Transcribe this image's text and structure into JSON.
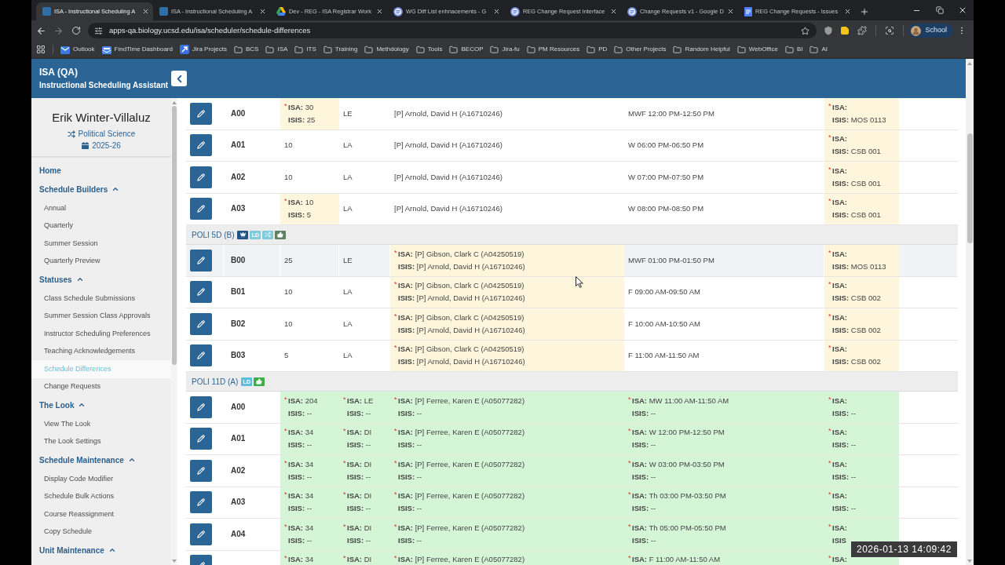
{
  "browser": {
    "tabs": [
      {
        "title": "ISA - Instructional Scheduling A",
        "kind": "app",
        "selected": true
      },
      {
        "title": "ISA - Instructional Scheduling A",
        "kind": "app",
        "selected": false
      },
      {
        "title": "Dev - REG - ISA Registrar Work",
        "kind": "drive",
        "selected": false
      },
      {
        "title": "WG Diff List enhnacements - G",
        "kind": "round",
        "selected": false
      },
      {
        "title": "REG Change Request Interface",
        "kind": "round",
        "selected": false
      },
      {
        "title": "Change Requests v1 - Google D",
        "kind": "round",
        "selected": false
      },
      {
        "title": "REG Change Requests - Issues",
        "kind": "doc",
        "selected": false
      }
    ],
    "address": "apps-qa.biology.ucsd.edu/isa/scheduler/schedule-differences",
    "profile": "School",
    "bookmarks": [
      {
        "label": "Outlook",
        "kind": "outlook"
      },
      {
        "label": "FindTime Dashboard",
        "kind": "findtime"
      },
      {
        "label": "Jira Projects",
        "kind": "jira"
      },
      {
        "label": "BCS",
        "kind": "folder"
      },
      {
        "label": "ISA",
        "kind": "folder"
      },
      {
        "label": "ITS",
        "kind": "folder"
      },
      {
        "label": "Training",
        "kind": "folder"
      },
      {
        "label": "Methdology",
        "kind": "folder"
      },
      {
        "label": "Tools",
        "kind": "folder"
      },
      {
        "label": "BECOP",
        "kind": "folder"
      },
      {
        "label": "Jira-fu",
        "kind": "folder"
      },
      {
        "label": "PM Resources",
        "kind": "folder"
      },
      {
        "label": "PD",
        "kind": "folder"
      },
      {
        "label": "Other Projects",
        "kind": "folder"
      },
      {
        "label": "Random Helpful",
        "kind": "folder"
      },
      {
        "label": "WebOffice",
        "kind": "folder"
      },
      {
        "label": "BI",
        "kind": "folder"
      },
      {
        "label": "AI",
        "kind": "folder"
      }
    ]
  },
  "header": {
    "title": "ISA (QA)",
    "subtitle": "Instructional Scheduling Assistant"
  },
  "sidebar": {
    "user": {
      "name": "Erik Winter-Villaluz",
      "department": "Political Science",
      "year": "2025-26"
    },
    "nav": [
      {
        "label": "Home",
        "kind": "link",
        "selected": false
      },
      {
        "label": "Schedule Builders",
        "kind": "group",
        "expanded": true,
        "children": [
          {
            "label": "Annual",
            "selected": false
          },
          {
            "label": "Quarterly",
            "selected": false
          },
          {
            "label": "Summer Session",
            "selected": false
          },
          {
            "label": "Quarterly Preview",
            "selected": false
          }
        ]
      },
      {
        "label": "Statuses",
        "kind": "group",
        "expanded": true,
        "children": [
          {
            "label": "Class Schedule Submissions",
            "selected": false
          },
          {
            "label": "Summer Session Class Approvals",
            "selected": false
          },
          {
            "label": "Instructor Scheduling Preferences",
            "selected": false
          },
          {
            "label": "Teaching Acknowledgements",
            "selected": false
          },
          {
            "label": "Schedule Differences",
            "selected": true
          },
          {
            "label": "Change Requests",
            "selected": false
          }
        ]
      },
      {
        "label": "The Look",
        "kind": "group",
        "expanded": true,
        "children": [
          {
            "label": "View The Look",
            "selected": false
          },
          {
            "label": "The Look Settings",
            "selected": false
          }
        ]
      },
      {
        "label": "Schedule Maintenance",
        "kind": "group",
        "expanded": true,
        "children": [
          {
            "label": "Display Code Modifier",
            "selected": false
          },
          {
            "label": "Schedule Bulk Actions",
            "selected": false
          },
          {
            "label": "Course Reassignment",
            "selected": false
          },
          {
            "label": "Copy Schedule",
            "selected": false
          }
        ]
      },
      {
        "label": "Unit Maintenance",
        "kind": "group",
        "expanded": true
      }
    ]
  },
  "table": {
    "groups": [
      {
        "rows": [
          {
            "kind": "changed",
            "hovered": false,
            "section": "A00",
            "cells": [
              {
                "kind": "diff",
                "mark": "*",
                "isa": "**ISA:** 30",
                "isis": "**ISIS:** 25"
              },
              {
                "kind": "plain",
                "text": "LE"
              },
              {
                "kind": "plain",
                "text": "[P] Arnold, David H (A16710246)"
              },
              {
                "kind": "plain",
                "text": "MWF 12:00 PM-12:50 PM"
              },
              {
                "kind": "diff",
                "mark": "*",
                "isa": "**ISA:**",
                "isis": "**ISIS:** MOS 0113"
              }
            ]
          },
          {
            "kind": "changed",
            "hovered": false,
            "section": "A01",
            "cells": [
              {
                "kind": "plain",
                "text": "10"
              },
              {
                "kind": "plain",
                "text": "LA"
              },
              {
                "kind": "plain",
                "text": "[P] Arnold, David H (A16710246)"
              },
              {
                "kind": "plain",
                "text": "W 06:00 PM-06:50 PM"
              },
              {
                "kind": "diff",
                "mark": "*",
                "isa": "**ISA:**",
                "isis": "**ISIS:** CSB 001"
              }
            ]
          },
          {
            "kind": "changed",
            "hovered": false,
            "section": "A02",
            "cells": [
              {
                "kind": "plain",
                "text": "10"
              },
              {
                "kind": "plain",
                "text": "LA"
              },
              {
                "kind": "plain",
                "text": "[P] Arnold, David H (A16710246)"
              },
              {
                "kind": "plain",
                "text": "W 07:00 PM-07:50 PM"
              },
              {
                "kind": "diff",
                "mark": "*",
                "isa": "**ISA:**",
                "isis": "**ISIS:** CSB 001"
              }
            ]
          },
          {
            "kind": "changed",
            "hovered": false,
            "section": "A03",
            "cells": [
              {
                "kind": "diff",
                "mark": "*",
                "isa": "**ISA:** 10",
                "isis": "**ISIS:** 5"
              },
              {
                "kind": "plain",
                "text": "LA"
              },
              {
                "kind": "plain",
                "text": "[P] Arnold, David H (A16710246)"
              },
              {
                "kind": "plain",
                "text": "W 08:00 PM-08:50 PM"
              },
              {
                "kind": "diff",
                "mark": "*",
                "isa": "**ISA:**",
                "isis": "**ISIS:** CSB 001"
              }
            ]
          }
        ]
      },
      {
        "header": {
          "title": "POLI 5D (B)",
          "badges": [
            {
              "kind": "crown",
              "color": "#1f5585"
            },
            {
              "kind": "text",
              "label": "LD",
              "color": "#7fcadb"
            },
            {
              "kind": "shuffle",
              "color": "#7fcadb"
            },
            {
              "kind": "thumbs-up",
              "color": "#5e8262"
            }
          ]
        },
        "rows": [
          {
            "kind": "changed",
            "hovered": true,
            "section": "B00",
            "cells": [
              {
                "kind": "plain",
                "text": "25"
              },
              {
                "kind": "plain",
                "text": "LE"
              },
              {
                "kind": "diff",
                "mark": "*",
                "isa": "**ISA:** [P] Gibson, Clark C (A04250519)",
                "isis": "**ISIS:** [P] Arnold, David H (A16710246)"
              },
              {
                "kind": "plain",
                "text": "MWF 01:00 PM-01:50 PM"
              },
              {
                "kind": "diff",
                "mark": "*",
                "isa": "**ISA:**",
                "isis": "**ISIS:** MOS 0113"
              }
            ]
          },
          {
            "kind": "changed",
            "hovered": false,
            "section": "B01",
            "cells": [
              {
                "kind": "plain",
                "text": "10"
              },
              {
                "kind": "plain",
                "text": "LA"
              },
              {
                "kind": "diff",
                "mark": "*",
                "isa": "**ISA:** [P] Gibson, Clark C (A04250519)",
                "isis": "**ISIS:** [P] Arnold, David H (A16710246)"
              },
              {
                "kind": "plain",
                "text": "F 09:00 AM-09:50 AM"
              },
              {
                "kind": "diff",
                "mark": "*",
                "isa": "**ISA:**",
                "isis": "**ISIS:** CSB 002"
              }
            ]
          },
          {
            "kind": "changed",
            "hovered": false,
            "section": "B02",
            "cells": [
              {
                "kind": "plain",
                "text": "10"
              },
              {
                "kind": "plain",
                "text": "LA"
              },
              {
                "kind": "diff",
                "mark": "*",
                "isa": "**ISA:** [P] Gibson, Clark C (A04250519)",
                "isis": "**ISIS:** [P] Arnold, David H (A16710246)"
              },
              {
                "kind": "plain",
                "text": "F 10:00 AM-10:50 AM"
              },
              {
                "kind": "diff",
                "mark": "*",
                "isa": "**ISA:**",
                "isis": "**ISIS:** CSB 002"
              }
            ]
          },
          {
            "kind": "changed",
            "hovered": false,
            "section": "B03",
            "cells": [
              {
                "kind": "plain",
                "text": "5"
              },
              {
                "kind": "plain",
                "text": "LA"
              },
              {
                "kind": "diff",
                "mark": "*",
                "isa": "**ISA:** [P] Gibson, Clark C (A04250519)",
                "isis": "**ISIS:** [P] Arnold, David H (A16710246)"
              },
              {
                "kind": "plain",
                "text": "F 11:00 AM-11:50 AM"
              },
              {
                "kind": "diff",
                "mark": "*",
                "isa": "**ISA:**",
                "isis": "**ISIS:** CSB 002"
              }
            ]
          }
        ]
      },
      {
        "header": {
          "title": "POLI 11D (A)",
          "badges": [
            {
              "kind": "text",
              "label": "LD",
              "color": "#5bc0de"
            },
            {
              "kind": "thumbs-up",
              "color": "#3fae49"
            }
          ]
        },
        "rows": [
          {
            "kind": "added",
            "hovered": false,
            "section": "A00",
            "cells": [
              {
                "kind": "diff",
                "mark": "*",
                "isa": "**ISA:** 204",
                "isis": "**ISIS:** --"
              },
              {
                "kind": "diff",
                "mark": "*",
                "isa": "**ISA:** LE",
                "isis": "**ISIS:** --"
              },
              {
                "kind": "diff",
                "mark": "*",
                "isa": "**ISA:** [P] Ferree, Karen E (A05077282)",
                "isis": "**ISIS:** --"
              },
              {
                "kind": "diff",
                "mark": "*",
                "isa": "**ISA:** MW 11:00 AM-11:50 AM",
                "isis": "**ISIS:** --"
              },
              {
                "kind": "diff",
                "mark": "*",
                "isa": "**ISA:**",
                "isis": "**ISIS:** --"
              }
            ]
          },
          {
            "kind": "added",
            "hovered": false,
            "section": "A01",
            "cells": [
              {
                "kind": "diff",
                "mark": "*",
                "isa": "**ISA:** 34",
                "isis": "**ISIS:** --"
              },
              {
                "kind": "diff",
                "mark": "*",
                "isa": "**ISA:** DI",
                "isis": "**ISIS:** --"
              },
              {
                "kind": "diff",
                "mark": "*",
                "isa": "**ISA:** [P] Ferree, Karen E (A05077282)",
                "isis": "**ISIS:** --"
              },
              {
                "kind": "diff",
                "mark": "*",
                "isa": "**ISA:** W 12:00 PM-12:50 PM",
                "isis": "**ISIS:** --"
              },
              {
                "kind": "diff",
                "mark": "*",
                "isa": "**ISA:**",
                "isis": "**ISIS:** --"
              }
            ]
          },
          {
            "kind": "added",
            "hovered": false,
            "section": "A02",
            "cells": [
              {
                "kind": "diff",
                "mark": "*",
                "isa": "**ISA:** 34",
                "isis": "**ISIS:** --"
              },
              {
                "kind": "diff",
                "mark": "*",
                "isa": "**ISA:** DI",
                "isis": "**ISIS:** --"
              },
              {
                "kind": "diff",
                "mark": "*",
                "isa": "**ISA:** [P] Ferree, Karen E (A05077282)",
                "isis": "**ISIS:** --"
              },
              {
                "kind": "diff",
                "mark": "*",
                "isa": "**ISA:** W 03:00 PM-03:50 PM",
                "isis": "**ISIS:** --"
              },
              {
                "kind": "diff",
                "mark": "*",
                "isa": "**ISA:**",
                "isis": "**ISIS:** --"
              }
            ]
          },
          {
            "kind": "added",
            "hovered": false,
            "section": "A03",
            "cells": [
              {
                "kind": "diff",
                "mark": "*",
                "isa": "**ISA:** 34",
                "isis": "**ISIS:** --"
              },
              {
                "kind": "diff",
                "mark": "*",
                "isa": "**ISA:** DI",
                "isis": "**ISIS:** --"
              },
              {
                "kind": "diff",
                "mark": "*",
                "isa": "**ISA:** [P] Ferree, Karen E (A05077282)",
                "isis": "**ISIS:** --"
              },
              {
                "kind": "diff",
                "mark": "*",
                "isa": "**ISA:** Th 03:00 PM-03:50 PM",
                "isis": "**ISIS:** --"
              },
              {
                "kind": "diff",
                "mark": "*",
                "isa": "**ISA:**",
                "isis": "**ISIS:** --"
              }
            ]
          },
          {
            "kind": "added",
            "hovered": false,
            "section": "A04",
            "cells": [
              {
                "kind": "diff",
                "mark": "*",
                "isa": "**ISA:** 34",
                "isis": "**ISIS:** --"
              },
              {
                "kind": "diff",
                "mark": "*",
                "isa": "**ISA:** DI",
                "isis": "**ISIS:** --"
              },
              {
                "kind": "diff",
                "mark": "*",
                "isa": "**ISA:** [P] Ferree, Karen E (A05077282)",
                "isis": "**ISIS:** --"
              },
              {
                "kind": "diff",
                "mark": "*",
                "isa": "**ISA:** Th 05:00 PM-05:50 PM",
                "isis": "**ISIS:** --"
              },
              {
                "kind": "diff",
                "mark": "*",
                "isa": "**ISA:**",
                "isis": "**ISIS**"
              }
            ]
          },
          {
            "kind": "added",
            "hovered": false,
            "cells": [
              {
                "kind": "diff",
                "mark": "*",
                "isa": "**ISA:** 34"
              },
              {
                "kind": "diff",
                "mark": "*",
                "isa": "**ISA:** DI"
              },
              {
                "kind": "diff",
                "mark": "*",
                "isa": "**ISA:** [P] Ferree, Karen E (A05077282)"
              },
              {
                "kind": "diff",
                "mark": "*",
                "isa": "**ISA:** F 11:00 AM-11:50 AM"
              },
              {
                "kind": "diff",
                "mark": "*",
                "isa": "**ISA:**"
              }
            ]
          }
        ]
      }
    ]
  },
  "overlay": {
    "timestamp": "2026-01-13 14:09:42"
  }
}
